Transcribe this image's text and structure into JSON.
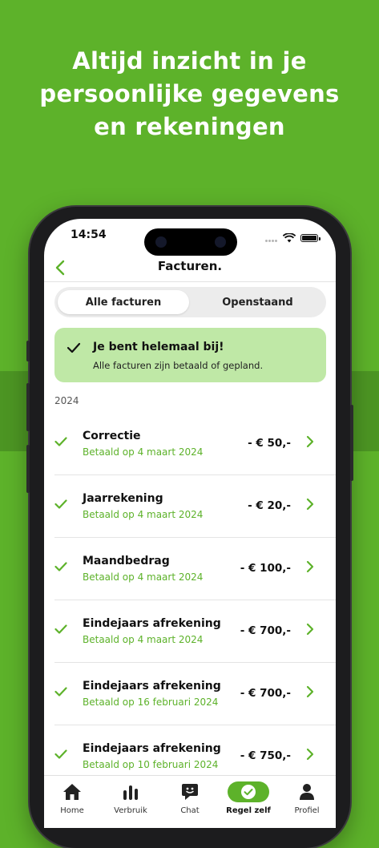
{
  "headline": {
    "line1": "Altijd inzicht in je",
    "line2": "persoonlijke gegevens",
    "line3": "en rekeningen"
  },
  "status_bar": {
    "time": "14:54"
  },
  "nav": {
    "title": "Facturen."
  },
  "segments": {
    "all": "Alle facturen",
    "open": "Openstaand"
  },
  "banner": {
    "title": "Je bent helemaal bij!",
    "text": "Alle facturen zijn betaald of gepland."
  },
  "year_label": "2024",
  "invoices": [
    {
      "title": "Correctie",
      "status": "Betaald op 4 maart 2024",
      "amount": "- € 50,-"
    },
    {
      "title": "Jaarrekening",
      "status": "Betaald op 4 maart 2024",
      "amount": "- € 20,-"
    },
    {
      "title": "Maandbedrag",
      "status": "Betaald op 4 maart 2024",
      "amount": "- € 100,-"
    },
    {
      "title": "Eindejaars afrekening",
      "status": "Betaald op 4 maart 2024",
      "amount": "- € 700,-"
    },
    {
      "title": "Eindejaars afrekening",
      "status": "Betaald op 16 februari 2024",
      "amount": "- € 700,-"
    },
    {
      "title": "Eindejaars afrekening",
      "status": "Betaald op 10 februari 2024",
      "amount": "- € 750,-"
    }
  ],
  "tabbar": {
    "home": "Home",
    "verbruik": "Verbruik",
    "chat": "Chat",
    "regel_zelf": "Regel zelf",
    "profiel": "Profiel"
  },
  "colors": {
    "brand_green": "#5db22a",
    "banner_green": "#bfe8a6",
    "background_green": "#5db22a"
  },
  "icons": [
    "back-chevron-icon",
    "wifi-icon",
    "battery-icon",
    "check-icon",
    "chevron-right-icon",
    "home-icon",
    "bar-chart-icon",
    "chat-icon",
    "check-circle-icon",
    "person-icon"
  ]
}
